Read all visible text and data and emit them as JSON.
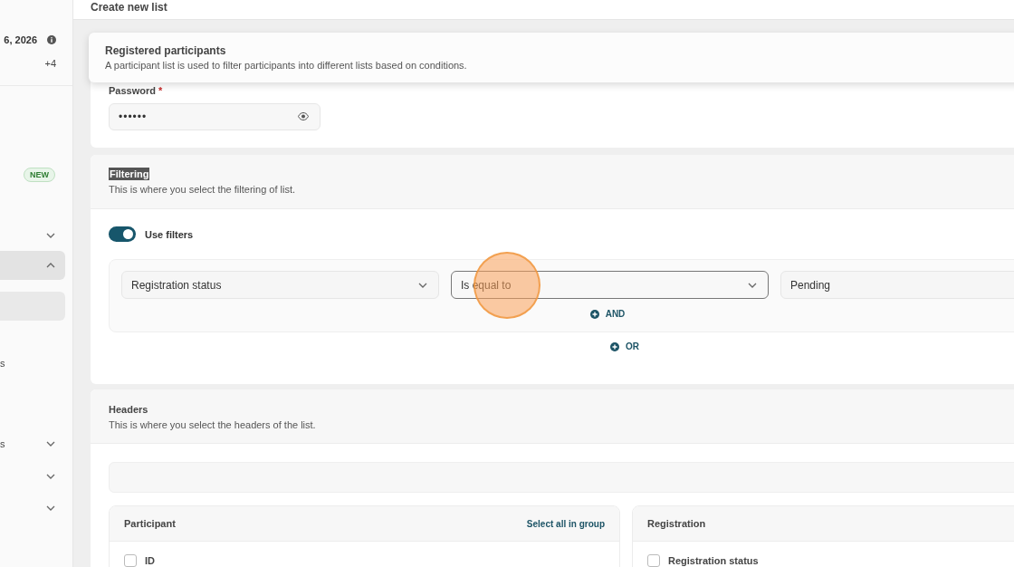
{
  "page_title": "Create new list",
  "sidebar": {
    "date_text": "6, 2026",
    "extra_count": "+4",
    "items": [
      {
        "kind": "badge",
        "badge": "NEW"
      },
      {
        "kind": "group",
        "expanded": false,
        "selected": false
      },
      {
        "kind": "group",
        "expanded": true,
        "selected": true
      },
      {
        "kind": "plain",
        "selected": true
      },
      {
        "kind": "plain",
        "label": "s",
        "selected": false
      },
      {
        "kind": "group",
        "label": "s",
        "expanded": false,
        "selected": false
      },
      {
        "kind": "group",
        "expanded": false,
        "selected": false
      },
      {
        "kind": "group",
        "expanded": false,
        "selected": false
      }
    ]
  },
  "sticky_header": {
    "title": "Registered participants",
    "description": "A participant list is used to filter participants into different lists based on conditions."
  },
  "password": {
    "label": "Password",
    "required_mark": "*",
    "value": "••••••"
  },
  "filtering": {
    "title": "Filtering",
    "title_highlighted": true,
    "description": "This is where you select the filtering of list.",
    "use_filters": {
      "label": "Use filters",
      "on": true
    },
    "conditions": [
      {
        "field": "Registration status",
        "operator": "Is equal to",
        "operator_focused": true,
        "value": "Pending"
      }
    ],
    "and_button": "AND",
    "or_button": "OR"
  },
  "headers": {
    "title": "Headers",
    "description": "This is where you select the headers of the list.",
    "groups": [
      {
        "title": "Participant",
        "select_all": "Select all in group",
        "fields": [
          {
            "label": "ID",
            "checked": false
          }
        ]
      },
      {
        "title": "Registration",
        "fields": [
          {
            "label": "Registration status",
            "checked": false
          }
        ]
      }
    ]
  }
}
